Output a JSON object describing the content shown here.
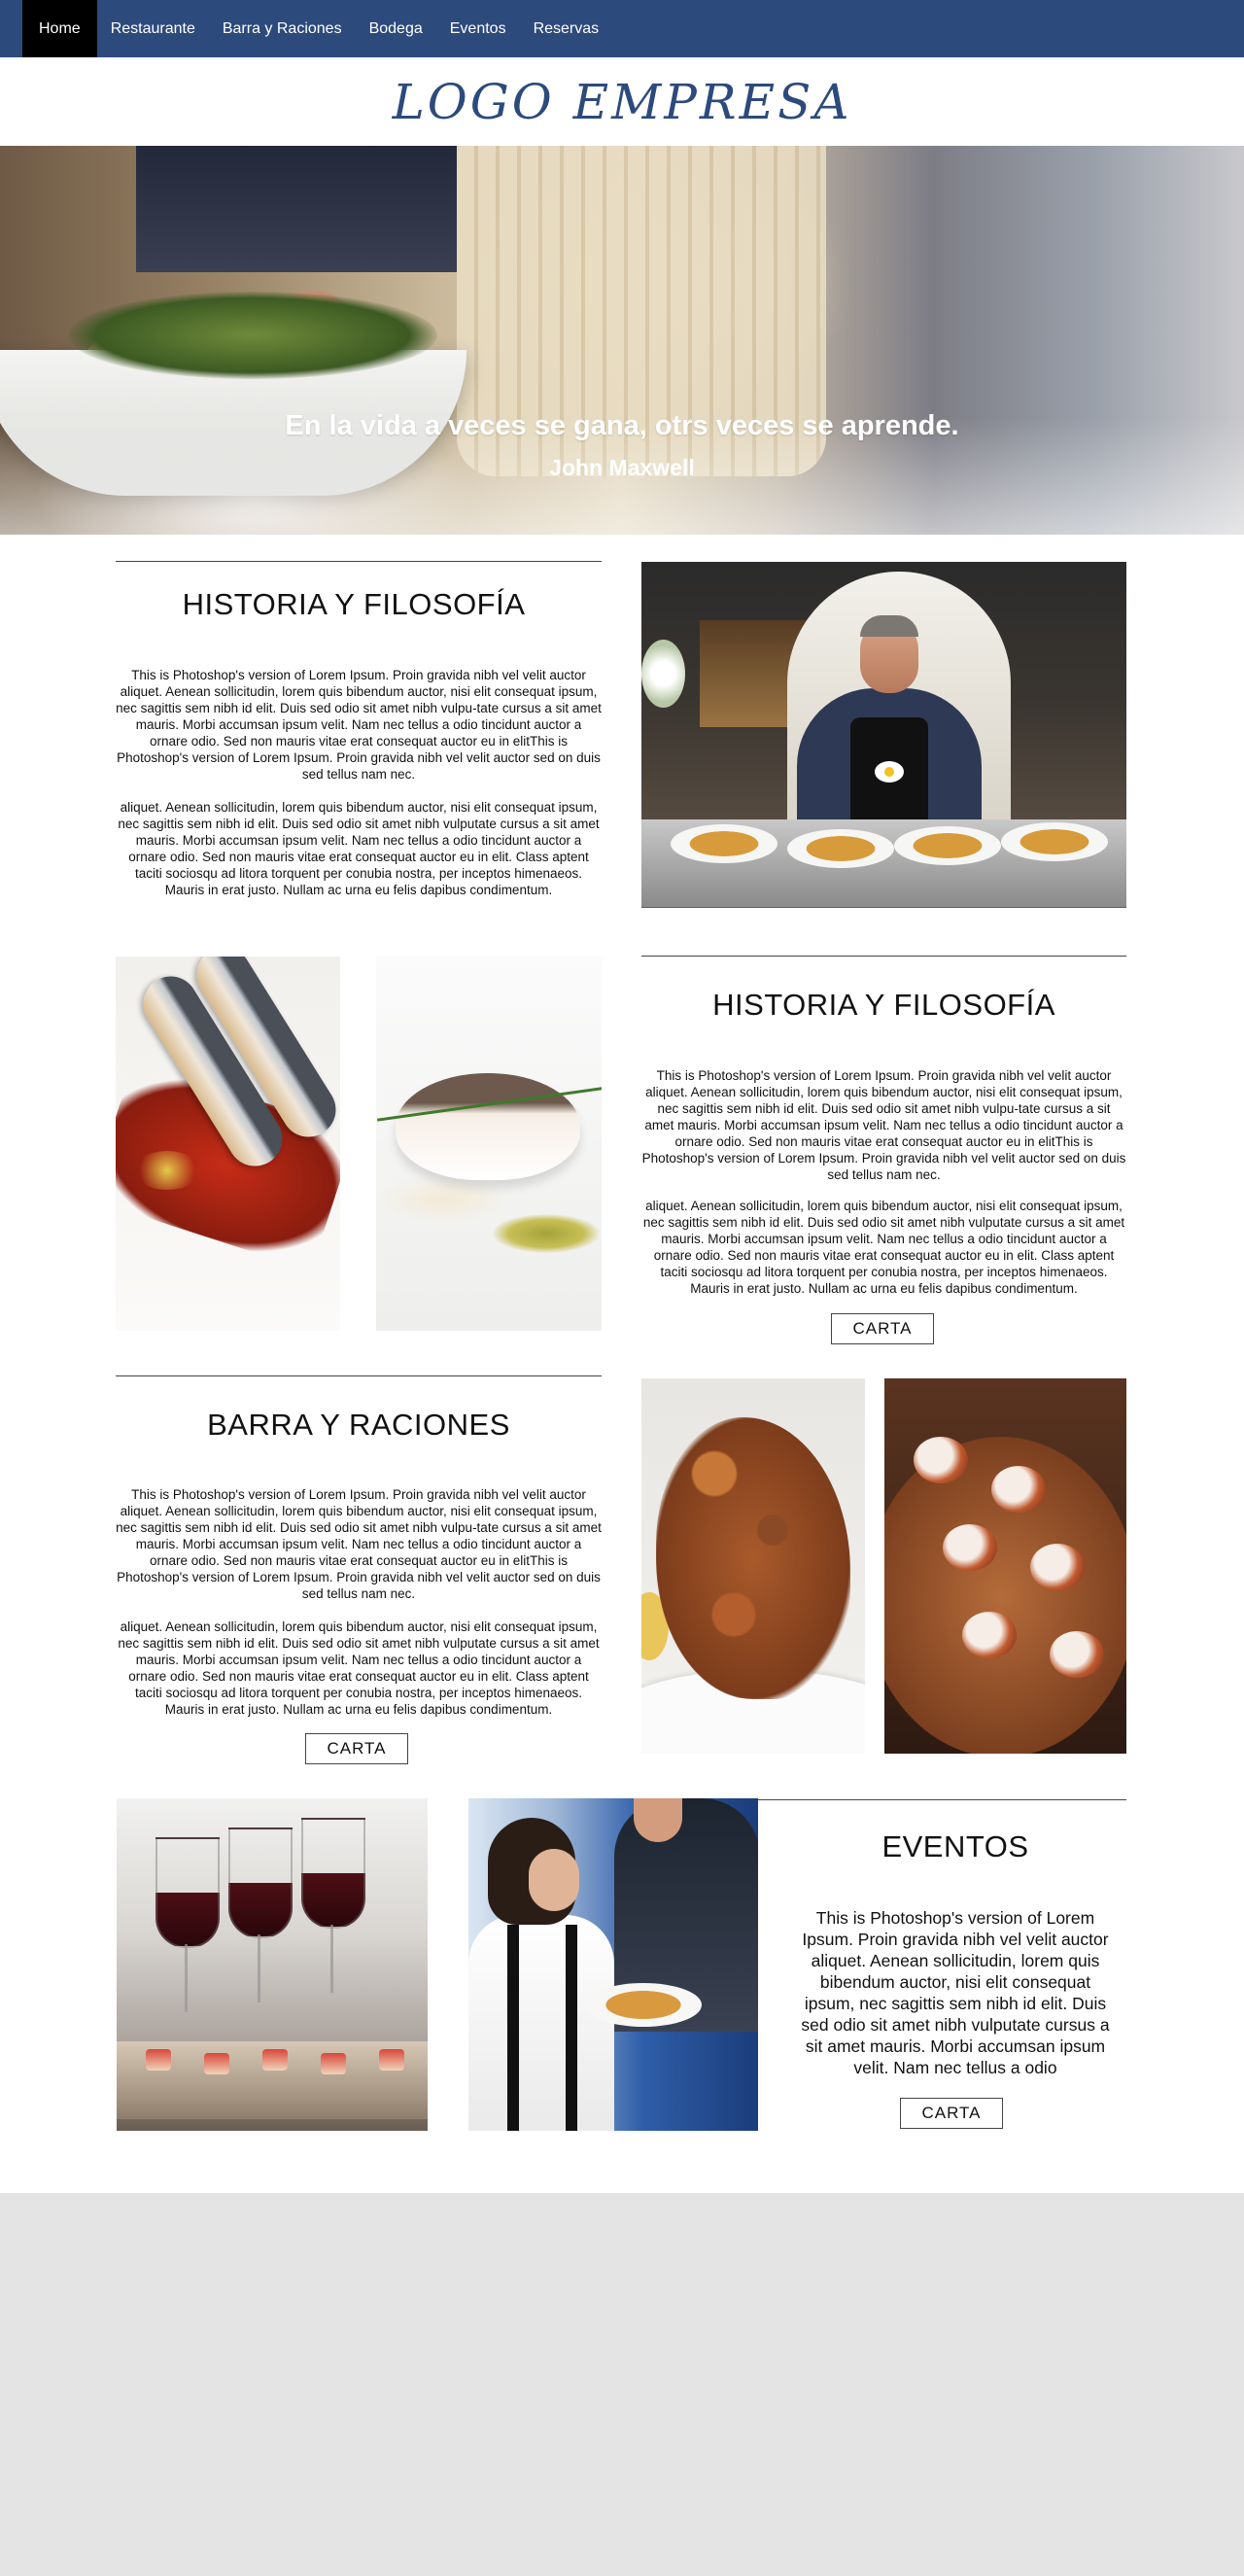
{
  "nav": {
    "items": [
      {
        "label": "Home",
        "active": true
      },
      {
        "label": "Restaurante"
      },
      {
        "label": "Barra y Raciones"
      },
      {
        "label": "Bodega"
      },
      {
        "label": "Eventos"
      },
      {
        "label": "Reservas"
      }
    ],
    "bg_color": "#2d4a7c",
    "active_bg": "#000000"
  },
  "logo": {
    "text": "LOGO EMPRESA",
    "color": "#2d4a7c"
  },
  "hero": {
    "quote": "En la vida a veces se gana, otrs veces se aprende.",
    "author": "John Maxwell"
  },
  "section1": {
    "title": "HISTORIA Y FILOSOFÍA",
    "paragraph1": "This is Photoshop's version  of Lorem Ipsum. Proin gravida nibh vel velit auctor aliquet. Aenean sollicitudin, lorem quis bibendum auctor, nisi elit consequat ipsum, nec sagittis sem nibh id elit. Duis sed odio sit amet nibh vulpu-tate cursus a sit amet mauris. Morbi accumsan ipsum velit. Nam nec tellus a odio tincidunt auctor a ornare odio. Sed non  mauris vitae erat consequat auctor eu in elitThis is Photoshop's version  of Lorem Ipsum. Proin gravida nibh vel velit auctor sed on duis sed tellus nam nec.",
    "paragraph2": "aliquet. Aenean sollicitudin, lorem quis bibendum auctor, nisi elit consequat ipsum, nec sagittis sem nibh id elit. Duis sed odio sit amet nibh vulputate cursus a sit amet mauris. Morbi accumsan ipsum velit. Nam nec tellus a odio tincidunt auctor a ornare odio. Sed non  mauris vitae erat consequat auctor eu in elit. Class aptent taciti sociosqu ad litora torquent per conubia nostra, per inceptos himenaeos. Mauris in erat justo. Nullam ac urna eu felis dapibus condimentum."
  },
  "section2": {
    "title": "HISTORIA Y FILOSOFÍA",
    "paragraph1": "This is Photoshop's version  of Lorem Ipsum. Proin gravida nibh vel velit auctor aliquet. Aenean sollicitudin, lorem quis bibendum auctor, nisi elit consequat ipsum, nec sagittis sem nibh id elit. Duis sed odio sit amet nibh vulpu-tate cursus a sit amet mauris. Morbi accumsan ipsum velit. Nam nec tellus a odio tincidunt auctor a ornare odio. Sed non  mauris vitae erat consequat auctor eu in elitThis is Photoshop's version  of Lorem Ipsum. Proin gravida nibh vel velit auctor sed on duis sed tellus nam nec.",
    "paragraph2": "aliquet. Aenean sollicitudin, lorem quis bibendum auctor, nisi elit consequat ipsum, nec sagittis sem nibh id elit. Duis sed odio sit amet nibh vulputate cursus a sit amet mauris. Morbi accumsan ipsum velit. Nam nec tellus a odio tincidunt auctor a ornare odio. Sed non  mauris vitae erat consequat auctor eu in elit. Class aptent taciti sociosqu ad litora torquent per conubia nostra, per inceptos himenaeos. Mauris in erat justo. Nullam ac urna eu felis dapibus condimentum.",
    "button": "CARTA"
  },
  "section3": {
    "title": "BARRA Y RACIONES",
    "paragraph1": "This is Photoshop's version  of Lorem Ipsum. Proin gravida nibh vel velit auctor aliquet. Aenean sollicitudin, lorem quis bibendum auctor, nisi elit consequat ipsum, nec sagittis sem nibh id elit. Duis sed odio sit amet nibh vulpu-tate cursus a sit amet mauris. Morbi accumsan ipsum velit. Nam nec tellus a odio tincidunt auctor a ornare odio. Sed non  mauris vitae erat consequat auctor eu in elitThis is Photoshop's version  of Lorem Ipsum. Proin gravida nibh vel velit auctor sed on duis sed tellus nam nec.",
    "paragraph2": "aliquet. Aenean sollicitudin, lorem quis bibendum auctor, nisi elit consequat ipsum, nec sagittis sem nibh id elit. Duis sed odio sit amet nibh vulputate cursus a sit amet mauris. Morbi accumsan ipsum velit. Nam nec tellus a odio tincidunt auctor a ornare odio. Sed non  mauris vitae erat consequat auctor eu in elit. Class aptent taciti sociosqu ad litora torquent per conubia nostra, per inceptos himenaeos. Mauris in erat justo. Nullam ac urna eu felis dapibus condimentum.",
    "button": "CARTA"
  },
  "section4": {
    "title": "EVENTOS",
    "paragraph": "This is Photoshop's version  of Lorem Ipsum. Proin gravida nibh vel velit auctor aliquet. Aenean sollicitudin, lorem quis bibendum auctor, nisi elit consequat ipsum, nec sagittis sem nibh id elit. Duis sed odio sit amet nibh vulputate cursus a sit amet mauris. Morbi accumsan ipsum velit. Nam nec tellus a odio",
    "button": "CARTA"
  }
}
